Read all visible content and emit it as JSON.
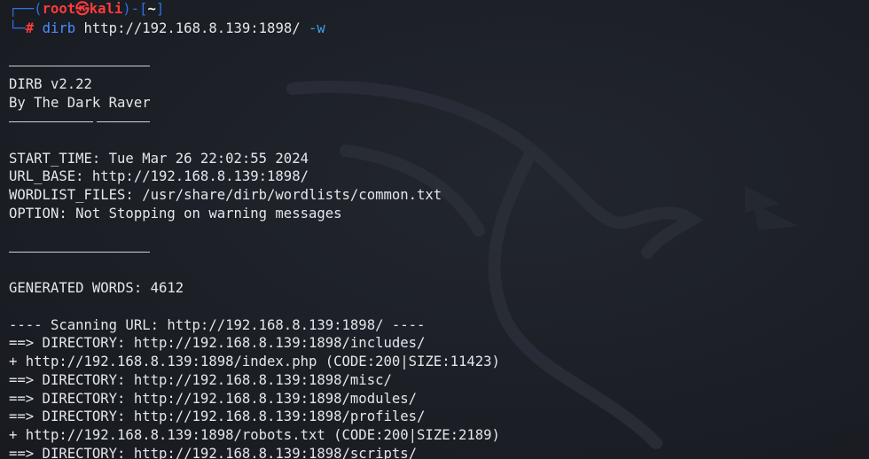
{
  "prompt": {
    "open": "┌──(",
    "user": "root",
    "at": "㉿",
    "host": "kali",
    "mid": ")-[",
    "dir": "~",
    "close": "]",
    "corner": "└─",
    "hash": "#",
    "command": "dirb",
    "argument": "http://192.168.8.139:1898/",
    "flag": "-w"
  },
  "banner": {
    "version": "DIRB v2.22",
    "author": "By The Dark Raver"
  },
  "info": {
    "start_time": "START_TIME: Tue Mar 26 22:02:55 2024",
    "url_base": "URL_BASE: http://192.168.8.139:1898/",
    "wordlist": "WORDLIST_FILES: /usr/share/dirb/wordlists/common.txt",
    "option": "OPTION: Not Stopping on warning messages"
  },
  "generated": "GENERATED WORDS: 4612",
  "scan_header": "---- Scanning URL: http://192.168.8.139:1898/ ----",
  "results": [
    "==> DIRECTORY: http://192.168.8.139:1898/includes/",
    "+ http://192.168.8.139:1898/index.php (CODE:200|SIZE:11423)",
    "==> DIRECTORY: http://192.168.8.139:1898/misc/",
    "==> DIRECTORY: http://192.168.8.139:1898/modules/",
    "==> DIRECTORY: http://192.168.8.139:1898/profiles/",
    "+ http://192.168.8.139:1898/robots.txt (CODE:200|SIZE:2189)",
    "==> DIRECTORY: http://192.168.8.139:1898/scripts/"
  ]
}
